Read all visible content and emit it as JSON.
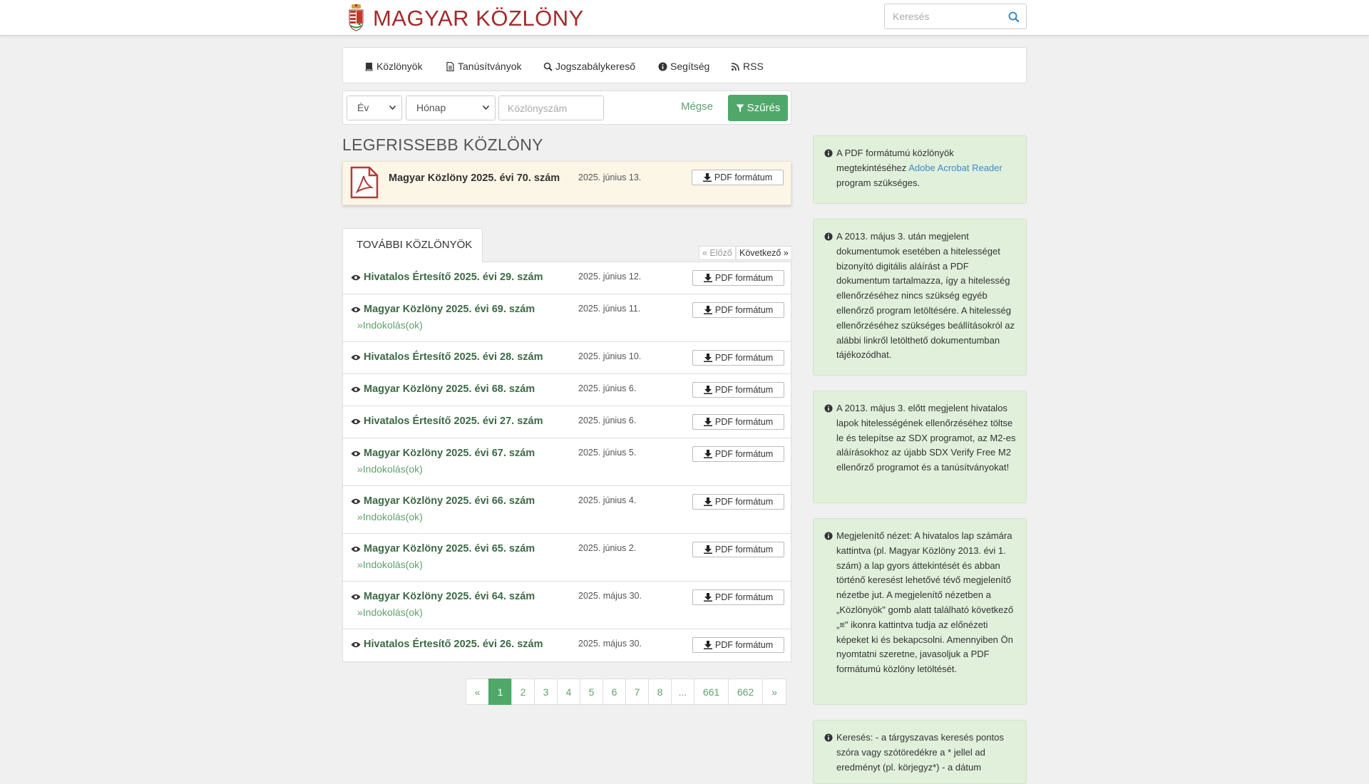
{
  "header": {
    "title": "MAGYAR KÖZLÖNY",
    "search_placeholder": "Keresés"
  },
  "nav": {
    "items": [
      {
        "label": "Közlönyök",
        "icon": "book-icon"
      },
      {
        "label": "Tanúsítványok",
        "icon": "document-icon"
      },
      {
        "label": "Jogszabálykereső",
        "icon": "search-zoom-icon"
      },
      {
        "label": "Segítség",
        "icon": "info-icon"
      },
      {
        "label": "RSS",
        "icon": "rss-icon"
      }
    ]
  },
  "filter": {
    "year_selected": "Év",
    "month_selected": "Hónap",
    "number_placeholder": "Közlönyszám",
    "cancel_label": "Mégse",
    "filter_label": "Szűrés"
  },
  "latest": {
    "heading": "LEGFRISSEBB KÖZLÖNY",
    "title": "Magyar Közlöny 2025. évi 70. szám",
    "date": "2025. június 13.",
    "pdf_label": "PDF formátum"
  },
  "more": {
    "tab_label": "TOVÁBBI KÖZLÖNYÖK",
    "prev_label": "« Előző",
    "next_label": "Következő »",
    "items": [
      {
        "title": "Hivatalos Értesítő 2025. évi 29. szám",
        "date": "2025. június 12.",
        "indok": ""
      },
      {
        "title": "Magyar Közlöny 2025. évi 69. szám",
        "date": "2025. június 11.",
        "indok": "»Indokolás(ok)"
      },
      {
        "title": "Hivatalos Értesítő 2025. évi 28. szám",
        "date": "2025. június 10.",
        "indok": ""
      },
      {
        "title": "Magyar Közlöny 2025. évi 68. szám",
        "date": "2025. június 6.",
        "indok": ""
      },
      {
        "title": "Hivatalos Értesítő 2025. évi 27. szám",
        "date": "2025. június 6.",
        "indok": ""
      },
      {
        "title": "Magyar Közlöny 2025. évi 67. szám",
        "date": "2025. június 5.",
        "indok": "»Indokolás(ok)"
      },
      {
        "title": "Magyar Közlöny 2025. évi 66. szám",
        "date": "2025. június 4.",
        "indok": "»Indokolás(ok)"
      },
      {
        "title": "Magyar Közlöny 2025. évi 65. szám",
        "date": "2025. június 2.",
        "indok": "»Indokolás(ok)"
      },
      {
        "title": "Magyar Közlöny 2025. évi 64. szám",
        "date": "2025. május 30.",
        "indok": "»Indokolás(ok)"
      },
      {
        "title": "Hivatalos Értesítő 2025. évi 26. szám",
        "date": "2025. május 30.",
        "indok": ""
      }
    ],
    "pdf_label": "PDF formátum"
  },
  "pagination": {
    "pages": [
      "«",
      "1",
      "2",
      "3",
      "4",
      "5",
      "6",
      "7",
      "8",
      "...",
      "661",
      "662",
      "»"
    ],
    "active": "1"
  },
  "side": {
    "box1_pre": "A PDF formátumú közlönyök megtekintéséhez ",
    "box1_link": "Adobe Acrobat Reader",
    "box1_post": " program szükséges.",
    "box2": "A 2013. május 3. után megjelent dokumentumok esetében a hitelességet bizonyító digitális aláírást a PDF dokumentum tartalmazza, így a hitelesség ellenőrzéséhez nincs szükség egyéb ellenőrző program letöltésére. A hitelesség ellenőrzéséhez szükséges beállításokról az alábbi linkről letölthető dokumentumban tájékozódhat.",
    "box3": "A 2013. május 3. előtt megjelent hivatalos lapok hitelességének ellenőrzéséhez töltse le és telepítse az SDX programot, az M2-es aláírásokhoz az újabb SDX Verify Free M2 ellenőrző programot és a tanúsítványokat!",
    "box4": "Megjelenítő nézet: A hivatalos lap számára kattintva (pl. Magyar Közlöny 2013. évi 1. szám) a lap gyors áttekintését és abban történő keresést lehetővé tévő megjelenítő nézetbe jut. A megjelenítő nézetben a „Közlönyök\" gomb alatt található következő „≡\" ikonra kattintva tudja az előnézeti képeket ki és bekapcsolni. Amennyiben Ön nyomtatni szeretne, javasoljuk a PDF formátumú közlöny letöltését.",
    "box5": "Keresés: - a tárgyszavas keresés pontos szóra vagy szótöredékre a * jellel ad eredményt (pl. körjegyz*) - a dátum"
  },
  "colors": {
    "brand_red": "#a32b2b",
    "accent_green": "#4fa86a",
    "link_green": "#3b6a45",
    "info_bg": "#e0f0db",
    "latest_bg": "#fcf6e6"
  }
}
